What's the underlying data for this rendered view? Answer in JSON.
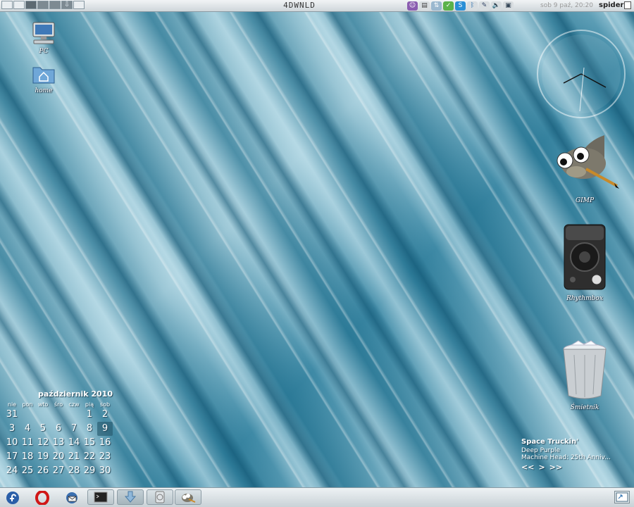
{
  "top_panel": {
    "title": "4DWNLD",
    "clock": "sob  9 paź, 20:20",
    "user": "spider"
  },
  "desktop": {
    "icons": [
      {
        "label": "PC",
        "icon": "computer-icon"
      },
      {
        "label": "home",
        "icon": "home-folder-icon"
      },
      {
        "label": "GIMP",
        "icon": "gimp-icon"
      },
      {
        "label": "Rhythmbox",
        "icon": "speaker-icon"
      },
      {
        "label": "Śmietnik",
        "icon": "trash-icon"
      }
    ]
  },
  "calendar": {
    "title": "październik 2010",
    "weekdays": [
      "nie",
      "pon",
      "wto",
      "śro",
      "czw",
      "pią",
      "sob"
    ],
    "weeks": [
      [
        "31",
        "",
        "",
        "",
        "",
        "1",
        "2"
      ],
      [
        "3",
        "4",
        "5",
        "6",
        "7",
        "8",
        "9"
      ],
      [
        "10",
        "11",
        "12",
        "13",
        "14",
        "15",
        "16"
      ],
      [
        "17",
        "18",
        "19",
        "20",
        "21",
        "22",
        "23"
      ],
      [
        "24",
        "25",
        "26",
        "27",
        "28",
        "29",
        "30"
      ]
    ],
    "today": "9"
  },
  "music": {
    "song": "Space Truckin'",
    "artist": "Deep Purple",
    "album": "Machine Head: 25th Anniv...",
    "prev": "<<",
    "play": ">",
    "next": ">>"
  },
  "taskbar": {
    "launchers": [
      "fedora-icon",
      "opera-icon",
      "thunderbird-icon"
    ],
    "tasks": [
      "terminal-icon",
      "download-icon",
      "disk-icon",
      "gimp-icon"
    ]
  },
  "colors": {
    "accent": "#2f7f9c",
    "panel": "#dfe6ea"
  }
}
